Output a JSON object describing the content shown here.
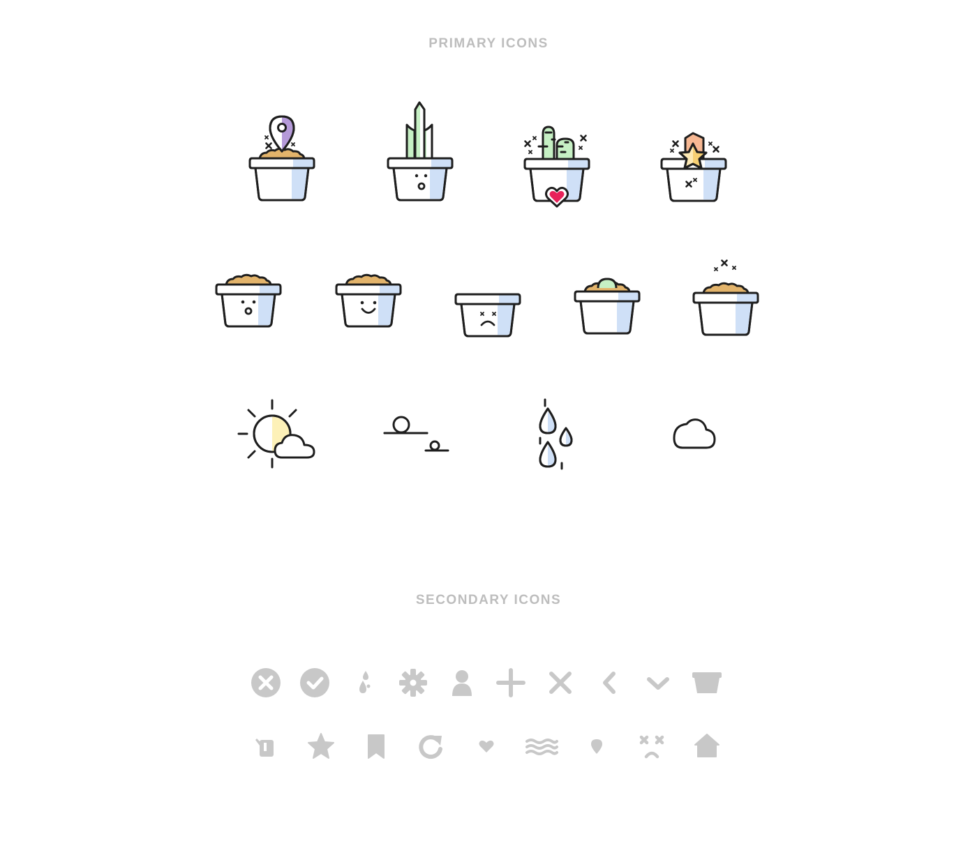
{
  "primary": {
    "heading": "PRIMARY ICONS",
    "row1": [
      "location-plant-pot-icon",
      "sprout-plant-pot-icon",
      "cactus-love-pot-icon",
      "star-sparkle-pot-icon"
    ],
    "row2": [
      "surprised-pot-icon",
      "happy-pot-icon",
      "dead-pot-icon",
      "bulb-pot-icon",
      "sparkle-pot-icon"
    ],
    "row3": [
      "sun-cloud-icon",
      "sunset-icon",
      "rain-icon",
      "cloud-icon"
    ]
  },
  "secondary": {
    "heading": "SECONDARY ICONS",
    "row1": [
      "close-circle-icon",
      "check-circle-icon",
      "drops-icon",
      "gear-icon",
      "user-icon",
      "plus-icon",
      "close-icon",
      "chevron-left-icon",
      "chevron-down-icon",
      "pot-icon"
    ],
    "row2": [
      "watering-can-icon",
      "star-icon",
      "bookmark-icon",
      "refresh-icon",
      "heart-icon",
      "waves-icon",
      "location-pin-icon",
      "dead-face-icon",
      "home-icon"
    ]
  },
  "colors": {
    "stroke": "#1e1e1e",
    "pot_shade": "#cfe0f7",
    "soil": "#e3b46b",
    "leaf_green": "#c6f0c4",
    "pin_purple": "#b59ad9",
    "heart_pink": "#e8225a",
    "sun_yellow": "#fdf1b8",
    "secondary_gray": "#c8c8c8",
    "heading_gray": "#bdbdbd"
  }
}
